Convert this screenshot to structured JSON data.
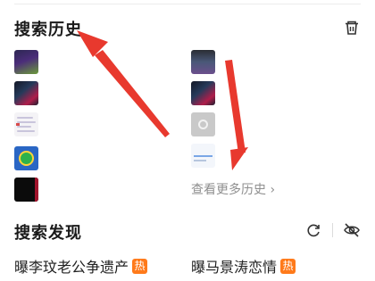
{
  "history": {
    "title": "搜索历史",
    "clear_icon": "trash-icon",
    "left_items": [
      "purple-green-thumbnail",
      "dark-game-thumbnail",
      "document-thumbnail",
      "blue-green-app-thumbnail",
      "black-thumbnail"
    ],
    "right_items": [
      "dark-landscape-thumbnail",
      "dark-game-thumbnail",
      "gray-screen-thumbnail",
      "light-document-thumbnail"
    ],
    "more_label": "查看更多历史 ›"
  },
  "discover": {
    "title": "搜索发现",
    "refresh_icon": "refresh-icon",
    "hide_icon": "eye-off-icon",
    "items": [
      {
        "label": "曝李玟老公争遗产",
        "badge": "热"
      },
      {
        "label": "曝马景涛恋情",
        "badge": "热"
      }
    ]
  },
  "annotation_color": "#e8392e",
  "hot_badge_color": "#ff7a1a"
}
